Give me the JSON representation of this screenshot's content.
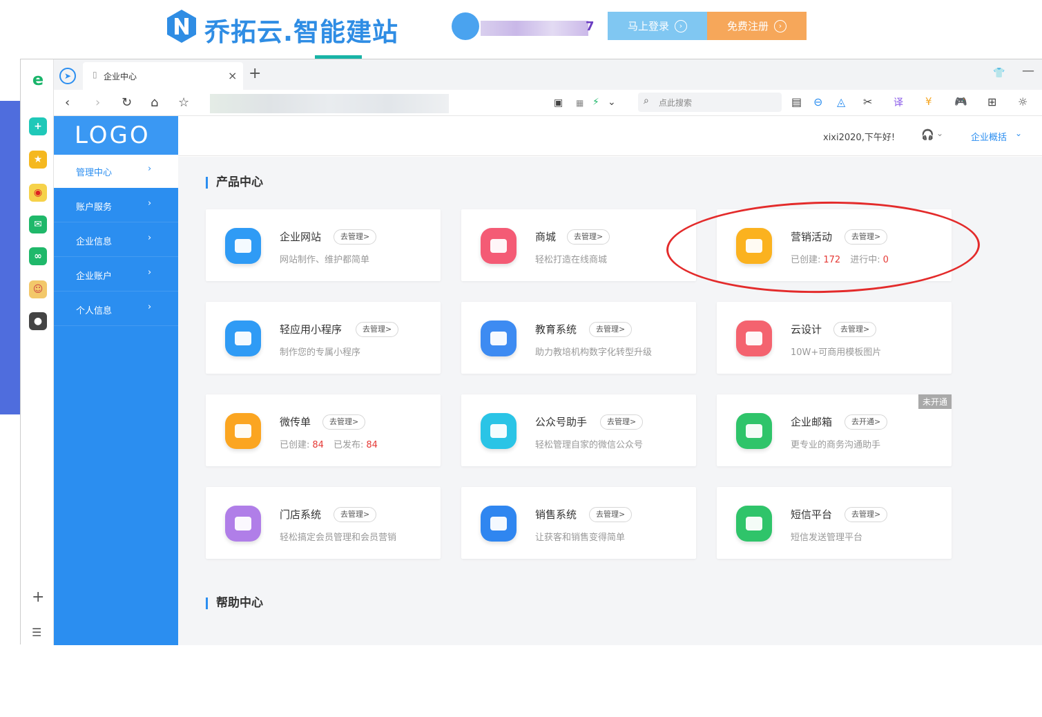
{
  "banner": {
    "brand": "乔拓云.智能建站",
    "user_tail": "7",
    "login_label": "马上登录",
    "register_label": "免费注册"
  },
  "browser": {
    "tab_title": "企业中心",
    "search_placeholder": "点此搜索"
  },
  "app": {
    "logo": "LOGO",
    "nav": [
      {
        "label": "管理中心"
      },
      {
        "label": "账户服务"
      },
      {
        "label": "企业信息"
      },
      {
        "label": "企业账户"
      },
      {
        "label": "个人信息"
      }
    ],
    "greeting": "xixi2020,下午好!",
    "overview_label": "企业概括"
  },
  "products": {
    "title": "产品中心",
    "cards": [
      {
        "name": "企业网站",
        "manage": "去管理>",
        "desc": "网站制作、维护都简单",
        "color": "#2f9bf5"
      },
      {
        "name": "商城",
        "manage": "去管理>",
        "desc": "轻松打造在线商城",
        "color": "#f45b75"
      },
      {
        "name": "营销活动",
        "manage": "去管理>",
        "stat1_label": "已创建:",
        "stat1_value": "172",
        "stat2_label": "进行中:",
        "stat2_value": "0",
        "color": "#fbb21f"
      },
      {
        "name": "轻应用小程序",
        "manage": "去管理>",
        "desc": "制作您的专属小程序",
        "color": "#2f9bf5"
      },
      {
        "name": "教育系统",
        "manage": "去管理>",
        "desc": "助力教培机构数字化转型升级",
        "color": "#3d8bf2"
      },
      {
        "name": "云设计",
        "manage": "去管理>",
        "desc": "10W+可商用模板图片",
        "color": "#f4636f"
      },
      {
        "name": "微传单",
        "manage": "去管理>",
        "stat1_label": "已创建:",
        "stat1_value": "84",
        "stat2_label": "已发布:",
        "stat2_value": "84",
        "color": "#fba521"
      },
      {
        "name": "公众号助手",
        "manage": "去管理>",
        "desc": "轻松管理自家的微信公众号",
        "color": "#2ac4e6"
      },
      {
        "name": "企业邮箱",
        "manage": "去开通>",
        "desc": "更专业的商务沟通助手",
        "badge": "未开通",
        "color": "#2fc46a"
      },
      {
        "name": "门店系统",
        "manage": "去管理>",
        "desc": "轻松搞定会员管理和会员营销",
        "color": "#b07ee8"
      },
      {
        "name": "销售系统",
        "manage": "去管理>",
        "desc": "让获客和销售变得简单",
        "color": "#2f86f0"
      },
      {
        "name": "短信平台",
        "manage": "去管理>",
        "desc": "短信发送管理平台",
        "color": "#2fc46a"
      }
    ]
  },
  "help": {
    "title": "帮助中心"
  }
}
